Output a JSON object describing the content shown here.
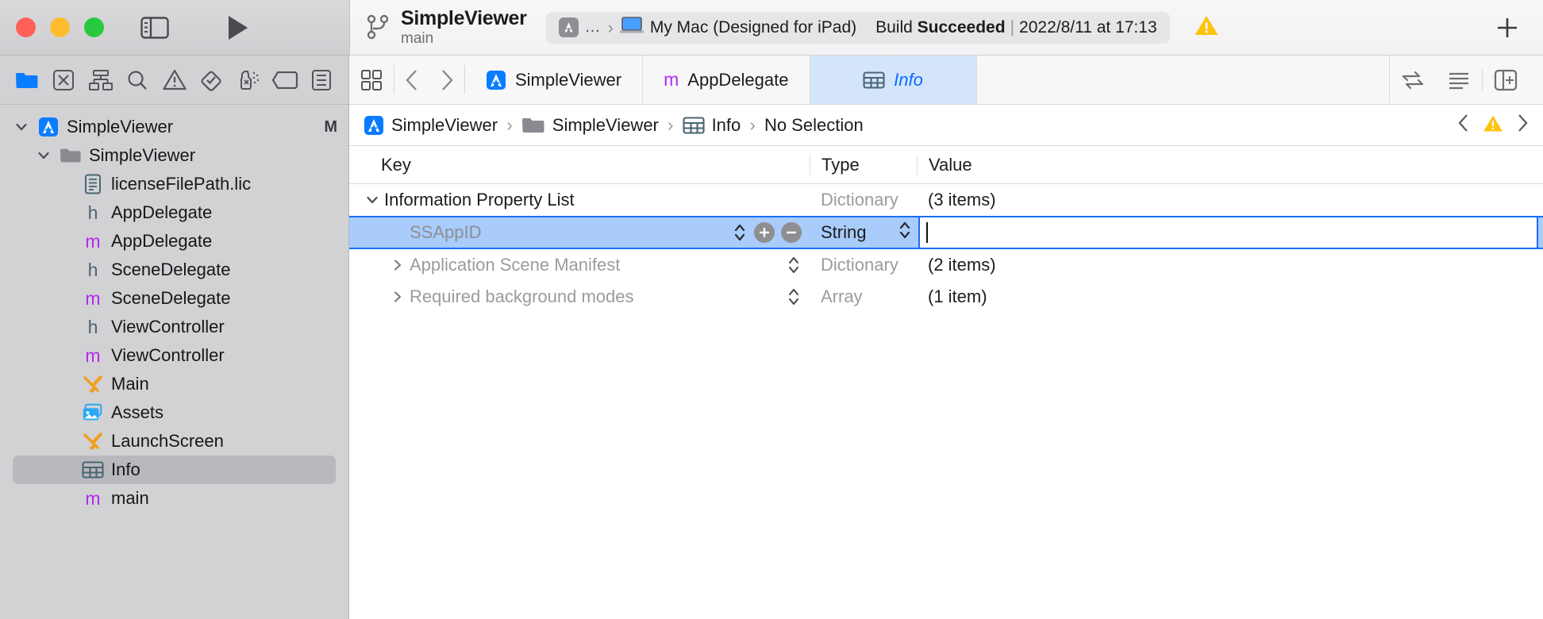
{
  "titlebar": {
    "window_controls": [
      "close",
      "minimize",
      "zoom"
    ],
    "sidebar_toggle_icon": "sidebar-toggle-icon",
    "run_icon": "run-play-icon",
    "scheme_name": "SimpleViewer",
    "branch_name": "main",
    "branch_icon": "source-control-branch-icon",
    "destination_ellipsis": "…",
    "destination_name": "My Mac (Designed for iPad)",
    "build_label": "Build",
    "build_result": "Succeeded",
    "build_separator": "|",
    "build_timestamp": "2022/8/11 at 17:13",
    "warning_icon": "warning-triangle-icon",
    "add_icon": "plus-icon"
  },
  "navigator": {
    "toolbar_icons": [
      "project-navigator-icon",
      "source-control-navigator-icon",
      "symbol-navigator-icon",
      "find-navigator-icon",
      "issue-navigator-icon",
      "test-navigator-icon",
      "debug-navigator-icon",
      "breakpoint-navigator-icon",
      "report-navigator-icon"
    ],
    "tree": [
      {
        "label": "SimpleViewer",
        "icon": "xcode-project-icon",
        "indent": 0,
        "twisty": "down",
        "badge": "M",
        "selected": false
      },
      {
        "label": "SimpleViewer",
        "icon": "folder-icon",
        "indent": 1,
        "twisty": "down",
        "badge": "",
        "selected": false
      },
      {
        "label": "licenseFilePath.lic",
        "icon": "text-file-icon",
        "indent": 2,
        "twisty": "",
        "badge": "",
        "selected": false
      },
      {
        "label": "AppDelegate",
        "icon": "header-file-icon",
        "indent": 2,
        "twisty": "",
        "badge": "",
        "selected": false
      },
      {
        "label": "AppDelegate",
        "icon": "objc-file-icon",
        "indent": 2,
        "twisty": "",
        "badge": "",
        "selected": false
      },
      {
        "label": "SceneDelegate",
        "icon": "header-file-icon",
        "indent": 2,
        "twisty": "",
        "badge": "",
        "selected": false
      },
      {
        "label": "SceneDelegate",
        "icon": "objc-file-icon",
        "indent": 2,
        "twisty": "",
        "badge": "",
        "selected": false
      },
      {
        "label": "ViewController",
        "icon": "header-file-icon",
        "indent": 2,
        "twisty": "",
        "badge": "",
        "selected": false
      },
      {
        "label": "ViewController",
        "icon": "objc-file-icon",
        "indent": 2,
        "twisty": "",
        "badge": "",
        "selected": false
      },
      {
        "label": "Main",
        "icon": "storyboard-icon",
        "indent": 2,
        "twisty": "",
        "badge": "",
        "selected": false
      },
      {
        "label": "Assets",
        "icon": "assets-catalog-icon",
        "indent": 2,
        "twisty": "",
        "badge": "",
        "selected": false
      },
      {
        "label": "LaunchScreen",
        "icon": "storyboard-icon",
        "indent": 2,
        "twisty": "",
        "badge": "",
        "selected": false
      },
      {
        "label": "Info",
        "icon": "plist-icon",
        "indent": 2,
        "twisty": "",
        "badge": "",
        "selected": true
      },
      {
        "label": "main",
        "icon": "objc-file-icon",
        "indent": 2,
        "twisty": "",
        "badge": "",
        "selected": false
      }
    ]
  },
  "editor": {
    "tabbar": {
      "grid_icon": "tab-overview-icon",
      "back_icon": "chevron-left-icon",
      "forward_icon": "chevron-right-icon",
      "tabs": [
        {
          "label": "SimpleViewer",
          "icon": "xcode-project-icon",
          "active": false
        },
        {
          "label": "AppDelegate",
          "icon": "objc-file-icon",
          "active": false
        },
        {
          "label": "Info",
          "icon": "plist-icon",
          "active": true
        }
      ],
      "right_icons": [
        "code-review-icon",
        "minimap-icon",
        "inspector-toggle-icon"
      ]
    },
    "jumpbar": {
      "crumbs": [
        {
          "label": "SimpleViewer",
          "icon": "xcode-project-icon"
        },
        {
          "label": "SimpleViewer",
          "icon": "folder-icon"
        },
        {
          "label": "Info",
          "icon": "plist-icon"
        },
        {
          "label": "No Selection",
          "icon": ""
        }
      ],
      "separator": "›",
      "back_icon": "chevron-left-icon",
      "warning_icon": "warning-triangle-icon",
      "forward_icon": "chevron-right-icon"
    },
    "plist": {
      "columns": {
        "key": "Key",
        "type": "Type",
        "value": "Value"
      },
      "rows": [
        {
          "key": "Information Property List",
          "type": "Dictionary",
          "value": "(3 items)",
          "indent": 0,
          "twisty": "down",
          "selected": false,
          "key_dim": false,
          "type_dim": true
        },
        {
          "key": "SSAppID",
          "type": "String",
          "value": "",
          "indent": 1,
          "twisty": "",
          "selected": true,
          "key_dim": true,
          "type_dim": false,
          "tools": [
            "sort-stepper",
            "add-button",
            "remove-button"
          ]
        },
        {
          "key": "Application Scene Manifest",
          "type": "Dictionary",
          "value": "(2 items)",
          "indent": 1,
          "twisty": "right",
          "selected": false,
          "key_dim": true,
          "type_dim": true,
          "has_stepper": true
        },
        {
          "key": "Required background modes",
          "type": "Array",
          "value": "(1 item)",
          "indent": 1,
          "twisty": "right",
          "selected": false,
          "key_dim": true,
          "type_dim": true,
          "has_stepper": true
        }
      ]
    }
  },
  "colors": {
    "accent_blue": "#0a6cff",
    "selection_blue": "#a9ccfb",
    "selection_border": "#1a6ff5",
    "active_tab_bg": "#d4e5fb",
    "objc_purple": "#b429f0",
    "header_teal": "#4a6572",
    "storyboard_orange": "#f0a020",
    "warning_yellow": "#ffc20e"
  }
}
